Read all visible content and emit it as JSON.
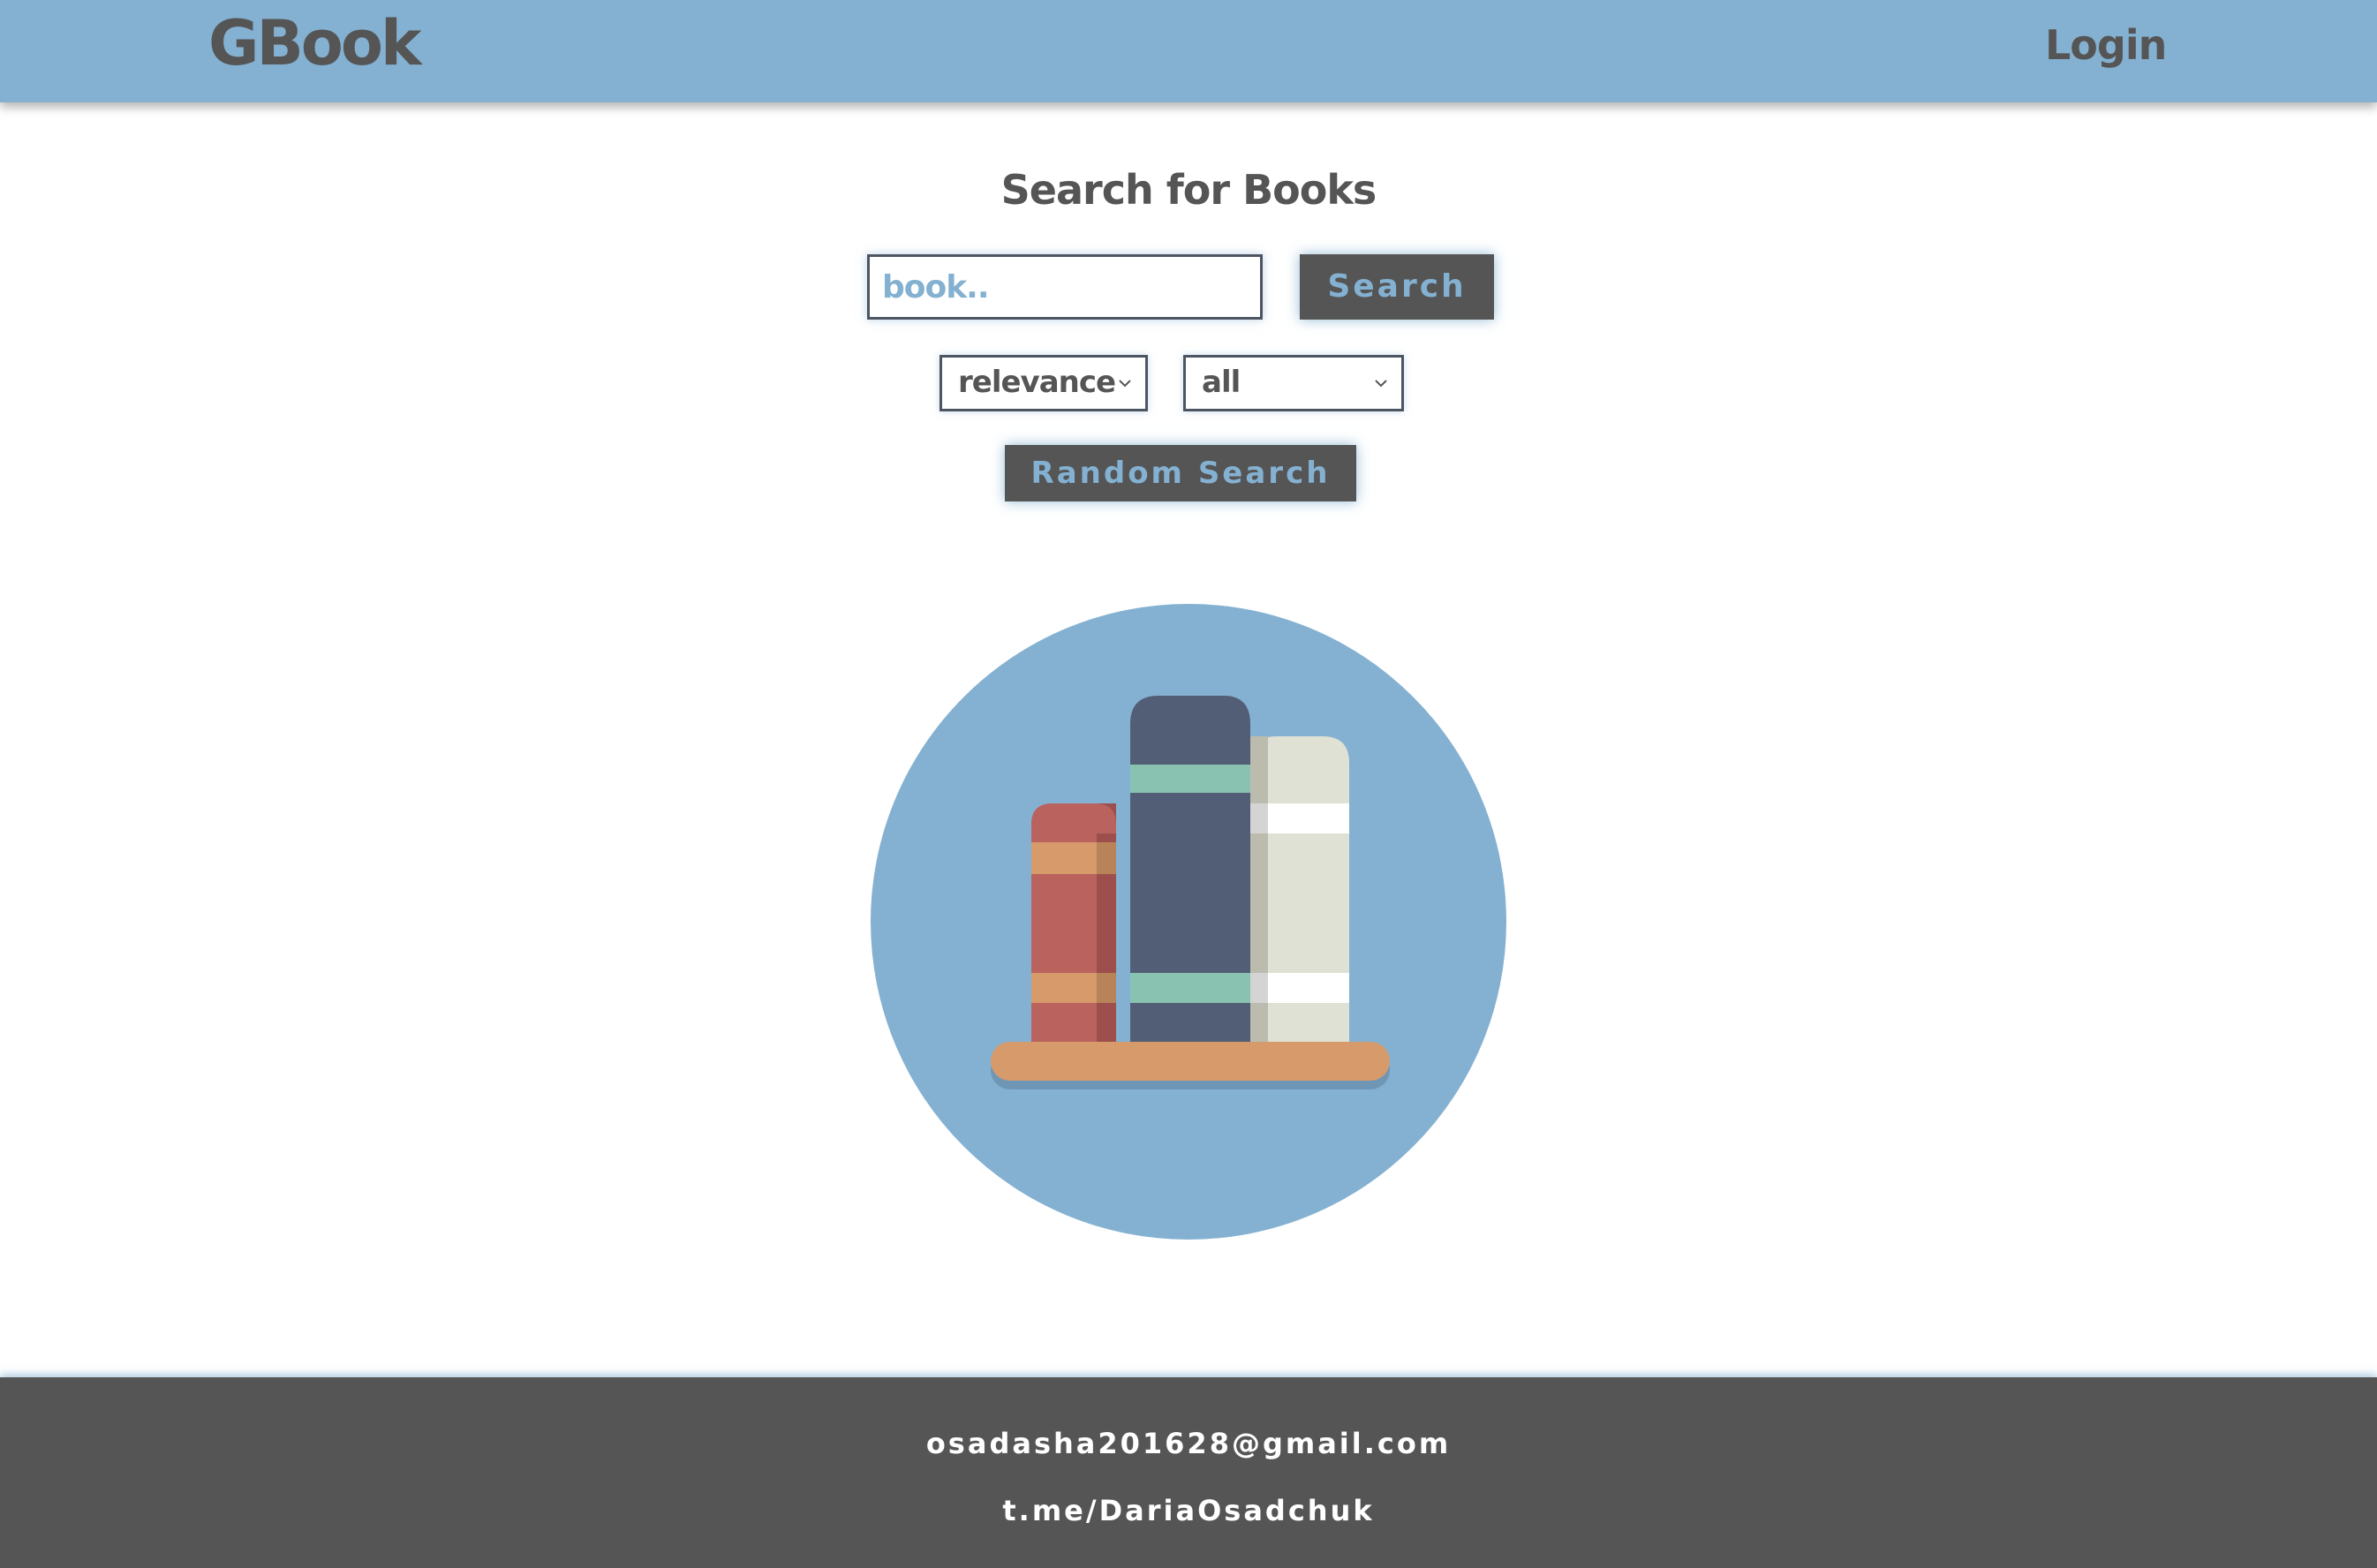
{
  "header": {
    "logo": "GBook",
    "login_label": "Login"
  },
  "main": {
    "title": "Search for Books",
    "search": {
      "placeholder": "book..",
      "value": "",
      "button_label": "Search"
    },
    "sort_select": {
      "selected": "relevance"
    },
    "filter_select": {
      "selected": "all"
    },
    "random_button_label": "Random Search"
  },
  "illustration": {
    "icon": "bookshelf-icon"
  },
  "footer": {
    "email": "osadasha201628@gmail.com",
    "telegram": "t.me/DariaOsadchuk"
  },
  "colors": {
    "header_bg": "#84b1d1",
    "text_dark": "#555555",
    "accent": "#84b1d1",
    "footer_bg": "#555555"
  }
}
